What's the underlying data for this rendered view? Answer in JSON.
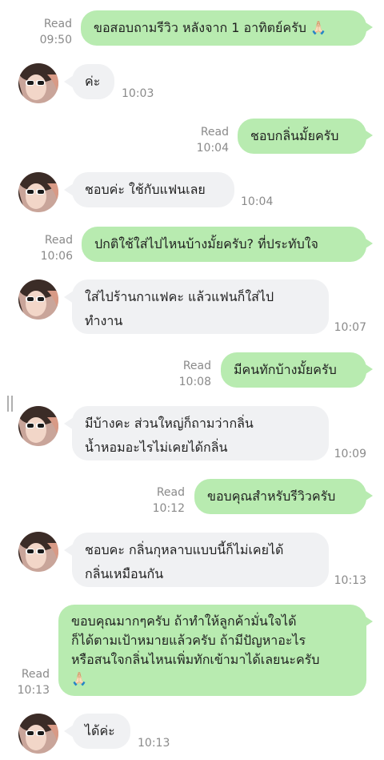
{
  "messages": [
    {
      "dir": "out",
      "text": "ขอสอบถามรีวิว หลังจาก 1 อาทิตย์ครับ 🙏🏻",
      "status": "Read",
      "time": "09:50"
    },
    {
      "dir": "in",
      "text": "ค่ะ",
      "time": "10:03"
    },
    {
      "dir": "out",
      "text": "ชอบกลิ่นมั้ยครับ",
      "status": "Read",
      "time": "10:04"
    },
    {
      "dir": "in",
      "text": "ชอบค่ะ ใช้กับแฟนเลย",
      "time": "10:04"
    },
    {
      "dir": "out",
      "text": "ปกติใช้ใส่ไปไหนบ้างมั้ยครับ? ที่ประทับใจ",
      "status": "Read",
      "time": "10:06"
    },
    {
      "dir": "in",
      "text": "ใส่ไปร้านกาแฟคะ แล้วแฟนก็ใส่ไป\nทำงาน",
      "time": "10:07"
    },
    {
      "dir": "out",
      "text": "มีคนทักบ้างมั้ยครับ",
      "status": "Read",
      "time": "10:08"
    },
    {
      "dir": "in",
      "text": "มีบ้างคะ ส่วนใหญ่ก็ถามว่ากลิ่น\nน้ำหอมอะไรไม่เคยได้กลิ่น",
      "time": "10:09"
    },
    {
      "dir": "out",
      "text": "ขอบคุณสำหรับรีวิวครับ",
      "status": "Read",
      "time": "10:12"
    },
    {
      "dir": "in",
      "text": "ชอบคะ กลิ่นกุหลาบแบบนี้ก็ไม่เคยได้\nกลิ่นเหมือนกัน",
      "time": "10:13"
    },
    {
      "dir": "out",
      "text": "ขอบคุณมากๆครับ ถ้าทำให้ลูกค้ามั่นใจได้\nก็ได้ตามเป้าหมายแล้วครับ ถ้ามีปัญหาอะไร\nหรือสนใจกลิ่นไหนเพิ่มทักเข้ามาได้เลยนะครับ\n🙏🏻",
      "status": "Read",
      "time": "10:13"
    },
    {
      "dir": "in",
      "text": "ได้ค่ะ",
      "time": "10:13"
    }
  ],
  "colors": {
    "outgoing_bubble": "#b8ebb0",
    "incoming_bubble": "#f0f1f3",
    "meta_text": "#8a8a8a"
  }
}
